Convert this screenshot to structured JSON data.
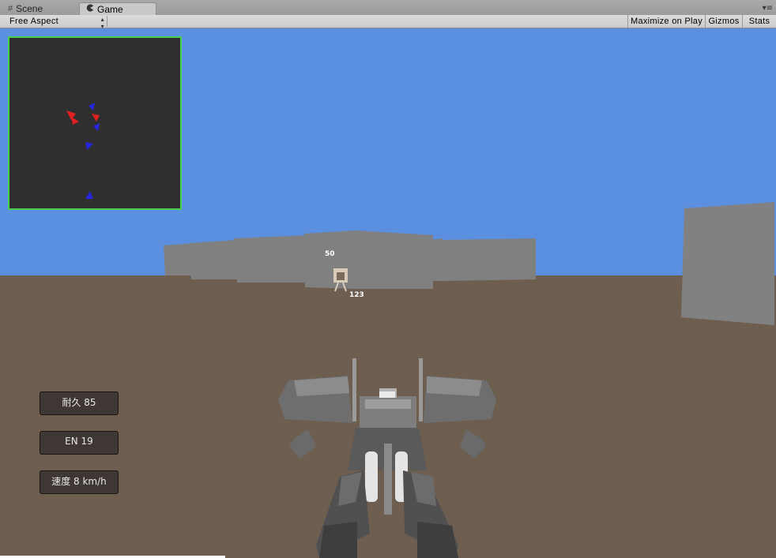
{
  "tabs": [
    {
      "label": "Scene",
      "icon": "grid-icon"
    },
    {
      "label": "Game",
      "icon": "pacman-icon"
    }
  ],
  "toolbar": {
    "aspect_value": "Free Aspect",
    "maximize_label": "Maximize on Play",
    "gizmos_label": "Gizmos",
    "stats_label": "Stats"
  },
  "colors": {
    "sky": "#5b8fe0",
    "ground": "#6d5e50",
    "minimap_border": "#4ccf4c",
    "enemy_marker": "#e02020",
    "ally_marker": "#2626e0"
  },
  "minimap": {
    "enemy_markers": 3,
    "ally_markers": 4
  },
  "hud": {
    "durability": "耐久 85",
    "energy": "EN 19",
    "speed": "速度 8 km/h"
  },
  "floating_numbers": {
    "target_upper": "50",
    "target_lower": "123"
  }
}
